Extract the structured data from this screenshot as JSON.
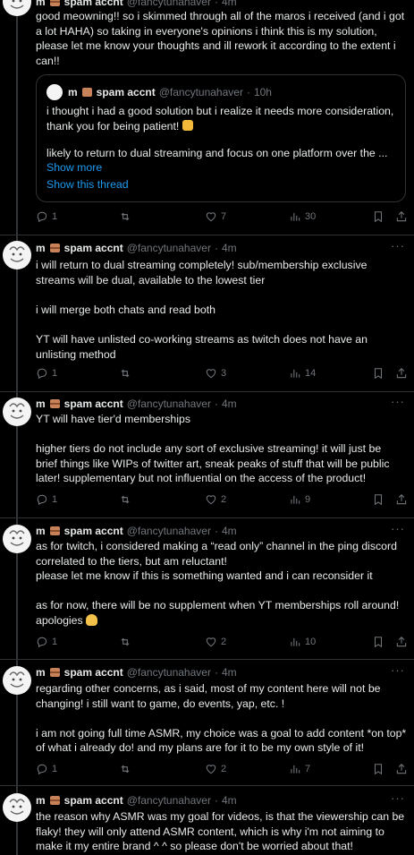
{
  "author": {
    "name": "m",
    "name_suffix": "spam accnt",
    "handle": "@fancytunahaver"
  },
  "tweets": [
    {
      "time": "4m",
      "text": "good meowning!! so i skimmed through all of the maros i received (and i got\na lot HAHA) so taking in everyone's opinions i think this is my solution,\nplease let me know your thoughts and ill rework it according to the extent i\ncan!!",
      "quote": {
        "name": "m",
        "name_suffix": "spam accnt",
        "handle": "@fancytunahaver",
        "time": "10h",
        "text": "i thought i had a good solution but i realize it needs more consideration,\nthank you for being patient! ",
        "text2": "likely to return to dual streaming and focus on one platform over the ...",
        "show_more": "Show more",
        "show_thread": "Show this thread"
      },
      "replies": "1",
      "retweets": "",
      "likes": "7",
      "views": "30"
    },
    {
      "time": "4m",
      "text": "i will return to dual streaming completely! sub/membership exclusive\nstreams will be dual, available to the lowest tier\n\ni will merge both chats and read both\n\nYT will have unlisted co-working streams as twitch does not have an\nunlisting method",
      "replies": "1",
      "retweets": "",
      "likes": "3",
      "views": "14"
    },
    {
      "time": "4m",
      "text": "YT will have tier'd memberships\n\nhigher tiers do not include any sort of exclusive streaming! it will just be\nbrief things like WIPs of twitter art, sneak peaks of stuff that will be public\nlater! supplementary but not influential on the access of the product!",
      "replies": "1",
      "retweets": "",
      "likes": "2",
      "views": "9"
    },
    {
      "time": "4m",
      "text": "as for twitch, i considered making a “read only” channel in the ping discord\ncorrelated to the tiers, but am reluctant!\nplease let me know if this is something wanted and i can reconsider it\n\nas for now, there will be no supplement when YT memberships roll around!\napologies ",
      "replies": "1",
      "retweets": "",
      "likes": "2",
      "views": "10"
    },
    {
      "time": "4m",
      "text": "regarding other concerns, as i said, most of my content here will not be\nchanging! i still want to game, do events, yap, etc. !\n\ni am not going full time ASMR, my choice was a goal to add content *on top*\nof what i already do! and my plans are for it to be my own style of it!",
      "replies": "1",
      "retweets": "",
      "likes": "2",
      "views": "7"
    },
    {
      "time": "4m",
      "text": "the reason why ASMR was my goal for videos, is that the viewership can be\nflaky! they will only attend ASMR content, which is why i'm not aiming to\nmake it my entire brand ^ ^ so please don't be worried about that!"
    }
  ],
  "icons": {
    "reply": "reply-icon",
    "retweet": "retweet-icon",
    "like": "heart-icon",
    "views": "views-icon",
    "bookmark": "bookmark-icon",
    "share": "share-icon",
    "more": "more-icon"
  },
  "colors": {
    "background": "#000000",
    "text": "#e7e9ea",
    "muted": "#71767b",
    "link": "#1d9bf0",
    "border": "#2f3336"
  }
}
